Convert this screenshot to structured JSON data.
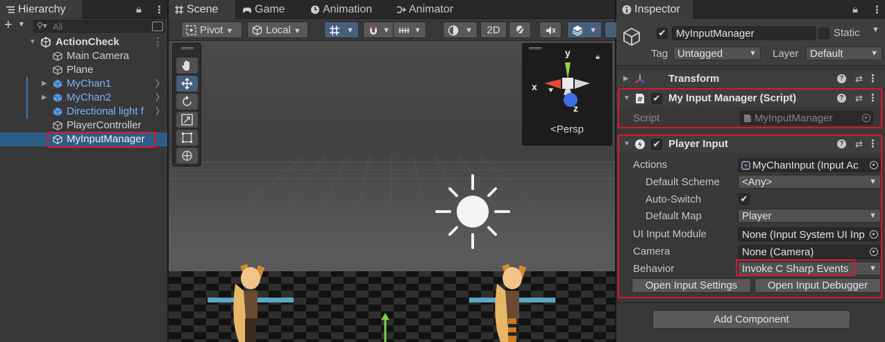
{
  "colors": {
    "highlight_red": "#e0162b",
    "selection_blue": "#2c5d87",
    "prefab_blue": "#7eb3f5",
    "panel_bg": "#383838"
  },
  "hierarchy": {
    "tab_label": "Hierarchy",
    "search_placeholder": "All",
    "items": [
      {
        "label": "ActionCheck",
        "icon": "unity-scene-icon"
      },
      {
        "label": "Main Camera",
        "icon": "cube-icon"
      },
      {
        "label": "Plane",
        "icon": "cube-icon"
      },
      {
        "label": "MyChan1",
        "icon": "prefab-cube-icon"
      },
      {
        "label": "MyChan2",
        "icon": "prefab-cube-icon"
      },
      {
        "label": "Directional light f",
        "icon": "prefab-cube-icon"
      },
      {
        "label": "PlayerController",
        "icon": "cube-icon"
      },
      {
        "label": "MyInputManager",
        "icon": "cube-icon"
      }
    ]
  },
  "scene": {
    "tabs": [
      {
        "label": "Scene",
        "icon": "grid-icon"
      },
      {
        "label": "Game",
        "icon": "gamepad-icon"
      },
      {
        "label": "Animation",
        "icon": "clock-icon"
      },
      {
        "label": "Animator",
        "icon": "animator-icon"
      }
    ],
    "toolbar": {
      "pivot": "Pivot",
      "local": "Local",
      "mode_2d": "2D"
    },
    "gizmo": {
      "y": "y",
      "x": "x",
      "z": "z",
      "persp": "<Persp"
    }
  },
  "inspector": {
    "tab_label": "Inspector",
    "object_name": "MyInputManager",
    "static_label": "Static",
    "tag_label": "Tag",
    "tag_value": "Untagged",
    "layer_label": "Layer",
    "layer_value": "Default",
    "transform": {
      "title": "Transform"
    },
    "script_component": {
      "title": "My Input Manager (Script)",
      "script_label": "Script",
      "script_value": "MyInputManager"
    },
    "player_input": {
      "title": "Player Input",
      "actions_label": "Actions",
      "actions_value": "MyChanInput (Input Ac",
      "default_scheme_label": "Default Scheme",
      "default_scheme_value": "<Any>",
      "auto_switch_label": "Auto-Switch",
      "default_map_label": "Default Map",
      "default_map_value": "Player",
      "ui_input_module_label": "UI Input Module",
      "ui_input_module_value": "None (Input System UI Inp",
      "camera_label": "Camera",
      "camera_value": "None (Camera)",
      "behavior_label": "Behavior",
      "behavior_value": "Invoke C Sharp Events",
      "open_settings": "Open Input Settings",
      "open_debugger": "Open Input Debugger"
    },
    "add_component": "Add Component"
  }
}
